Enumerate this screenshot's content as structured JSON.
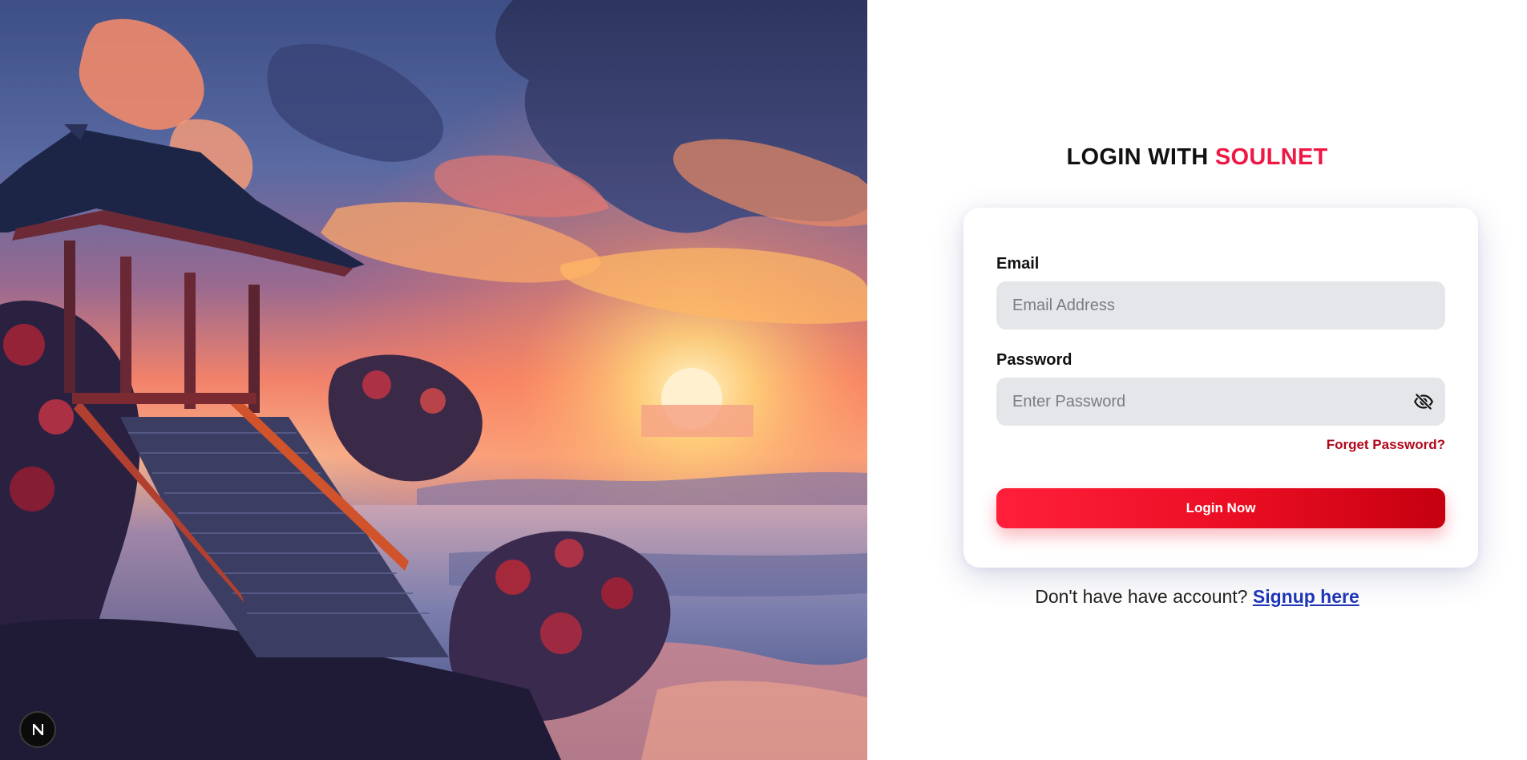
{
  "hero": {
    "image": "sunset-pagoda-landscape",
    "badge_icon": "next-n-logo-icon"
  },
  "title": {
    "prefix": "LOGIN WITH",
    "brand": "SOULNET"
  },
  "form": {
    "email": {
      "label": "Email",
      "placeholder": "Email Address",
      "value": ""
    },
    "password": {
      "label": "Password",
      "placeholder": "Enter Password",
      "value": "",
      "toggle_icon": "eye-slash-icon"
    },
    "forgot_label": "Forget Password?",
    "submit_label": "Login Now"
  },
  "signup": {
    "prompt": "Don't have have account?",
    "link_label": "Signup here"
  },
  "colors": {
    "brand": "#ee1845",
    "button_start": "#ff1f3b",
    "button_end": "#c50010",
    "forgot": "#b0081a",
    "signup_link": "#1f35b8",
    "input_bg": "#e5e6ea"
  }
}
